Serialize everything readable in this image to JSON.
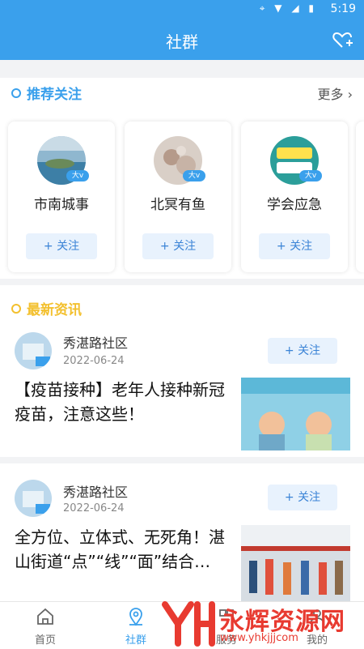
{
  "status": {
    "time": "5:19"
  },
  "header": {
    "title": "社群"
  },
  "recommend": {
    "title": "推荐关注",
    "more": "更多",
    "cards": [
      {
        "name": "市南城事",
        "badge": "大v",
        "follow": "+ 关注"
      },
      {
        "name": "北冥有鱼",
        "badge": "大v",
        "follow": "+ 关注"
      },
      {
        "name": "学会应急",
        "badge": "大v",
        "follow": "+ 关注"
      }
    ]
  },
  "news": {
    "title": "最新资讯",
    "items": [
      {
        "source": "秀湛路社区",
        "date": "2022-06-24",
        "follow": "+ 关注",
        "headline": "【疫苗接种】老年人接种新冠疫苗，注意这些！"
      },
      {
        "source": "秀湛路社区",
        "date": "2022-06-24",
        "follow": "+ 关注",
        "headline": "全方位、立体式、无死角！湛山街道“点”“线”“面”结合…"
      }
    ]
  },
  "tabs": [
    {
      "label": "首页"
    },
    {
      "label": "社群"
    },
    {
      "label": "服务"
    },
    {
      "label": "我的"
    }
  ],
  "watermark": {
    "text": "永辉资源网",
    "url": "www.yhkjjjcom"
  },
  "colors": {
    "accent": "#3aa0ec",
    "recommend_dot": "#3aa0ec",
    "news_dot": "#f3c02e",
    "watermark": "#e83a30"
  }
}
